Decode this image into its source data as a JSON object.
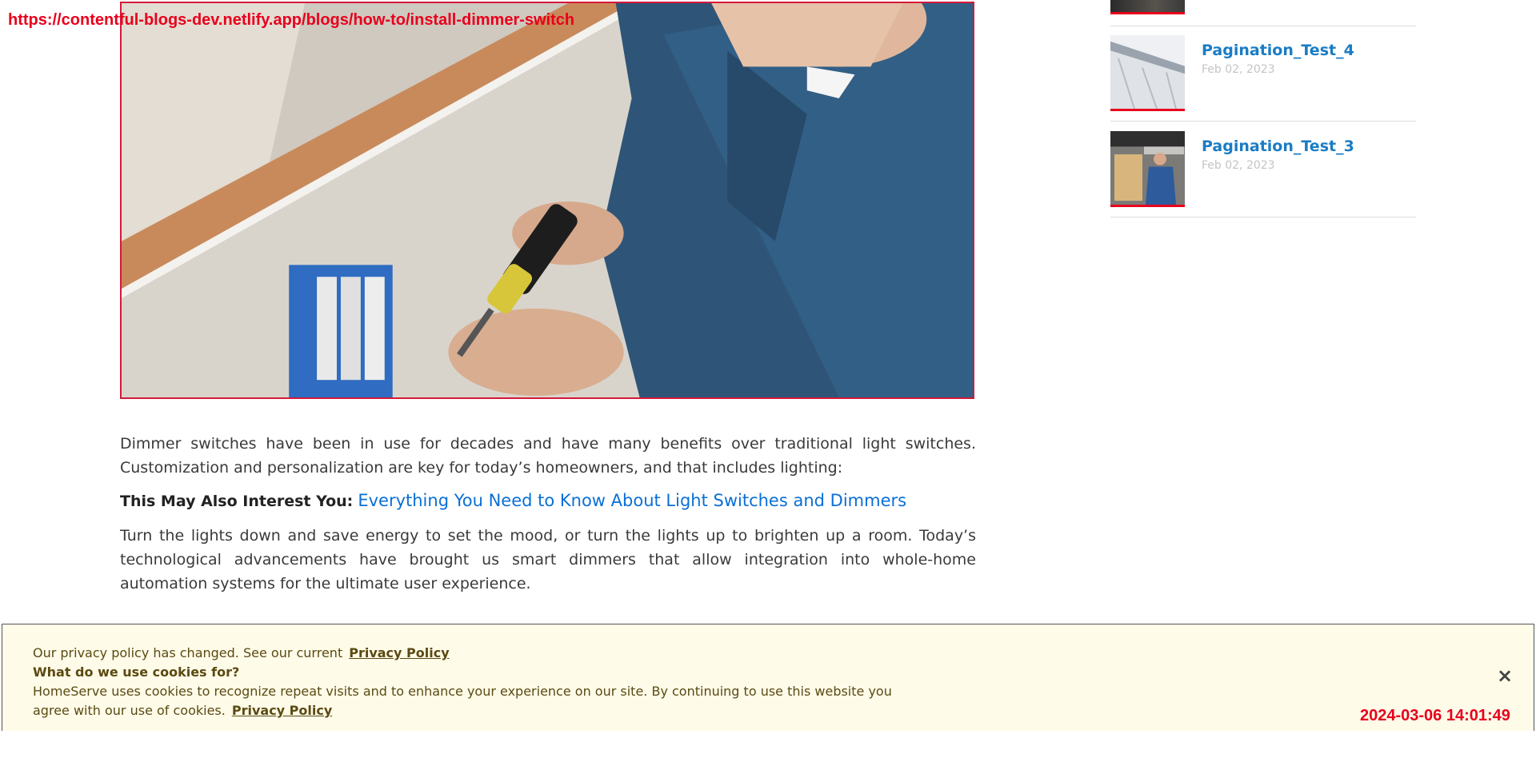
{
  "overlay": {
    "url": "https://contentful-blogs-dev.netlify.app/blogs/how-to/install-dimmer-switch",
    "timestamp": "2024-03-06 14:01:49"
  },
  "hero": {
    "alt": "Electrician installing a dimmer switch with a screwdriver"
  },
  "article": {
    "paragraph1": "Dimmer switches have been in use for decades and have many benefits over traditional light switches. Customization and personalization are key for today’s homeowners, and that includes lighting:",
    "interest_lead": "This May Also Interest You:",
    "interest_link": "Everything You Need to Know About Light Switches and Dimmers",
    "paragraph2": "Turn the lights down and save energy to set the mood, or turn the lights up to brighten up a room. Today’s technological advancements have brought us smart dimmers that allow integration into whole-home automation systems for the ultimate user experience."
  },
  "sidebar": {
    "items": [
      {
        "title": "Pagination_Test_4",
        "date": "Feb 02, 2023"
      },
      {
        "title": "Pagination_Test_3",
        "date": "Feb 02, 2023"
      }
    ]
  },
  "cookie": {
    "line1": "Our privacy policy has changed. See our current",
    "policy_link": "Privacy Policy",
    "heading": "What do we use cookies for?",
    "body1": "HomeServe uses cookies to recognize repeat visits and to enhance your experience on our site. By continuing to use this website you",
    "body2": "agree with our use of cookies.",
    "close_label": "×"
  },
  "colors": {
    "accent_red": "#e8001c",
    "link_blue": "#0a6fd6",
    "sidebar_link": "#1a7cc4",
    "cookie_bg": "#fffbe9"
  }
}
